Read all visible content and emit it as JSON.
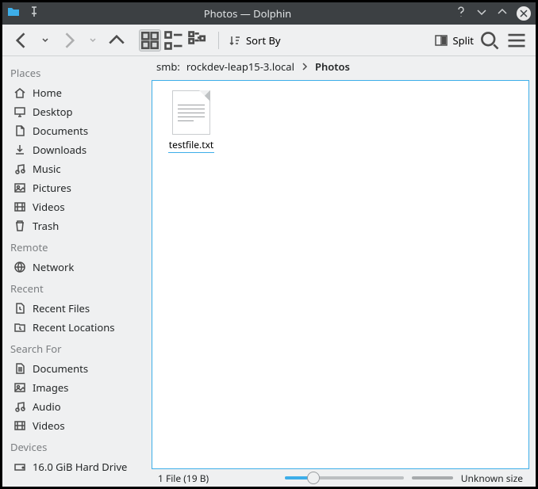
{
  "window": {
    "title": "Photos — Dolphin"
  },
  "toolbar": {
    "sort_label": "Sort By",
    "split_label": "Split"
  },
  "breadcrumb": {
    "prefix": "smb:",
    "host": "rockdev-leap15-3.local",
    "current": "Photos"
  },
  "sidebar": {
    "places": {
      "header": "Places",
      "items": [
        "Home",
        "Desktop",
        "Documents",
        "Downloads",
        "Music",
        "Pictures",
        "Videos",
        "Trash"
      ]
    },
    "remote": {
      "header": "Remote",
      "items": [
        "Network"
      ]
    },
    "recent": {
      "header": "Recent",
      "items": [
        "Recent Files",
        "Recent Locations"
      ]
    },
    "search": {
      "header": "Search For",
      "items": [
        "Documents",
        "Images",
        "Audio",
        "Videos"
      ]
    },
    "devices": {
      "header": "Devices",
      "items": [
        "16.0 GiB Hard Drive"
      ]
    }
  },
  "files": [
    {
      "name": "testfile.txt"
    }
  ],
  "status": {
    "count": "1 File (19 B)",
    "size": "Unknown size"
  }
}
